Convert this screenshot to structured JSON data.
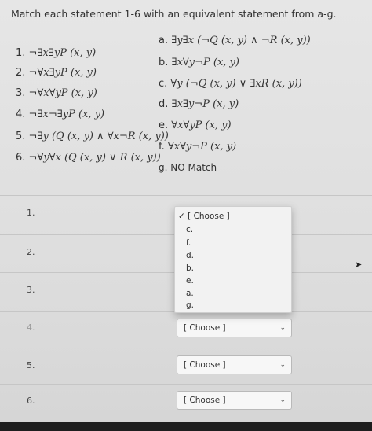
{
  "question": "Match each statement 1-6 with an equivalent statement from a-g.",
  "left_statements": [
    {
      "num": "1.",
      "expr": "¬∃x∃yP (x, y)"
    },
    {
      "num": "2.",
      "expr": "¬∀x∃yP (x, y)"
    },
    {
      "num": "3.",
      "expr": "¬∀x∀yP (x, y)"
    },
    {
      "num": "4.",
      "expr": "¬∃x¬∃yP (x, y)"
    },
    {
      "num": "5.",
      "expr": "¬∃y (Q (x, y) ∧ ∀x¬R (x, y))"
    },
    {
      "num": "6.",
      "expr": "¬∀y∀x (Q (x, y) ∨ R (x, y))"
    }
  ],
  "right_statements": [
    {
      "label": "a.",
      "expr": "∃y∃x (¬Q (x, y) ∧ ¬R (x, y))"
    },
    {
      "label": "b.",
      "expr": "∃x∀y¬P (x, y)"
    },
    {
      "label": "c.",
      "expr": "∀y (¬Q (x, y) ∨ ∃xR (x, y))"
    },
    {
      "label": "d.",
      "expr": "∃x∃y¬P (x, y)"
    },
    {
      "label": "e.",
      "expr": "∀x∀yP (x, y)"
    },
    {
      "label": "f.",
      "expr": "∀x∀y¬P (x, y)"
    },
    {
      "label": "g.",
      "expr": "NO Match"
    }
  ],
  "answer_rows": [
    {
      "num": "1."
    },
    {
      "num": "2."
    },
    {
      "num": "3."
    },
    {
      "num": "4.",
      "select": "[ Choose ]"
    },
    {
      "num": "5.",
      "select": "[ Choose ]"
    },
    {
      "num": "6.",
      "select": "[ Choose ]"
    }
  ],
  "dropdown": {
    "options": [
      "✓ [ Choose ]",
      "c.",
      "f.",
      "d.",
      "b.",
      "e.",
      "a.",
      "g."
    ]
  },
  "icons": {
    "chevron": "chevron-down-icon",
    "cursor": "mouse-pointer-icon"
  }
}
